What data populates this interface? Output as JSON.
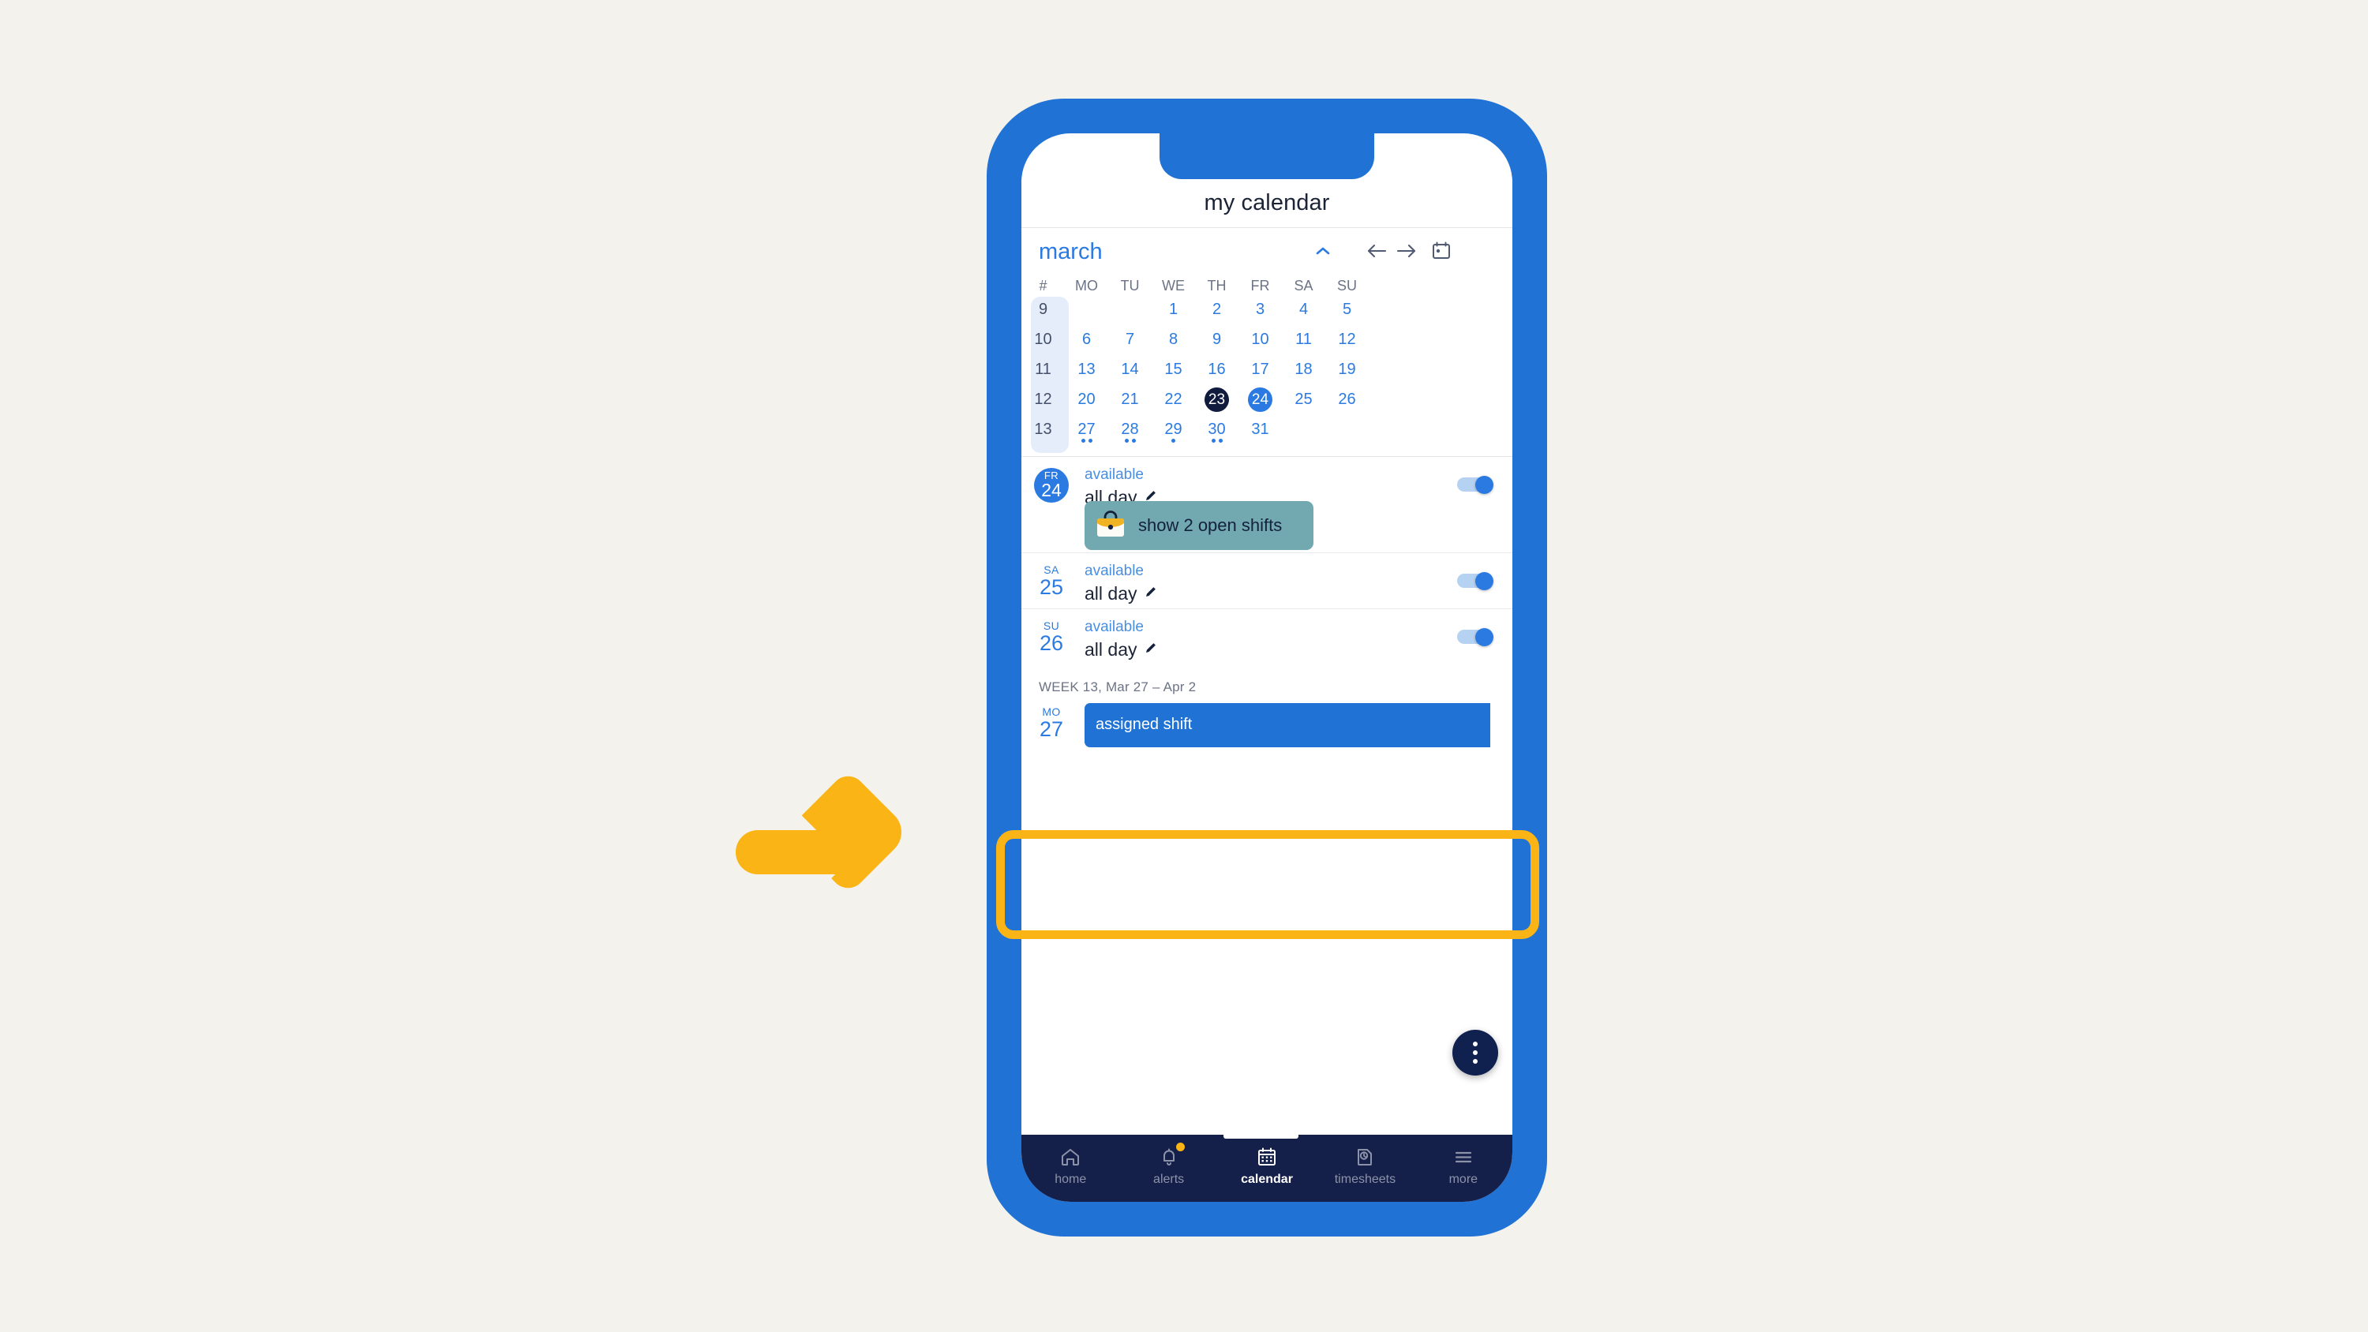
{
  "annotation": {
    "arrow_icon": "arrow-right-icon",
    "arrow_color": "#fbb415",
    "highlight_color": "#fbb415",
    "highlight_target": "saturday-25-availability-row"
  },
  "theme": {
    "background": "#f4f2ed",
    "phone_frame": "#2072d4",
    "accent_blue": "#2a7ae2",
    "dark_navy": "#15204a",
    "today_dark": "#101b3d",
    "teal_button": "#72a8b0",
    "amber": "#fbb415"
  },
  "header": {
    "title": "my calendar"
  },
  "month_bar": {
    "month": "march",
    "collapse_icon": "chevron-up-icon",
    "prev_icon": "arrow-left-icon",
    "next_icon": "arrow-right-icon",
    "today_icon": "calendar-today-icon"
  },
  "calendar": {
    "weeknum_header": "#",
    "day_headers": [
      "MO",
      "TU",
      "WE",
      "TH",
      "FR",
      "SA",
      "SU"
    ],
    "weeks": [
      {
        "num": "9",
        "days": [
          "",
          "",
          "1",
          "2",
          "3",
          "4",
          "5"
        ]
      },
      {
        "num": "10",
        "days": [
          "6",
          "7",
          "8",
          "9",
          "10",
          "11",
          "12"
        ]
      },
      {
        "num": "11",
        "days": [
          "13",
          "14",
          "15",
          "16",
          "17",
          "18",
          "19"
        ]
      },
      {
        "num": "12",
        "days": [
          "20",
          "21",
          "22",
          "23",
          "24",
          "25",
          "26"
        ]
      },
      {
        "num": "13",
        "days": [
          "27",
          "28",
          "29",
          "30",
          "31",
          "",
          ""
        ]
      }
    ],
    "today": "23",
    "selected": "24",
    "event_dots": {
      "27": 2,
      "28": 2,
      "29": 1,
      "30": 2
    }
  },
  "agenda": {
    "rows": [
      {
        "day_of_week": "FR",
        "day_number": "24",
        "status": "available",
        "time": "all day",
        "edit_icon": "pencil-icon",
        "toggle_on": true,
        "open_shifts_label": "show 2 open shifts",
        "open_shifts_icon": "briefcase-icon"
      },
      {
        "day_of_week": "SA",
        "day_number": "25",
        "status": "available",
        "time": "all day",
        "edit_icon": "pencil-icon",
        "toggle_on": true
      },
      {
        "day_of_week": "SU",
        "day_number": "26",
        "status": "available",
        "time": "all day",
        "edit_icon": "pencil-icon",
        "toggle_on": true
      }
    ],
    "week_header": "WEEK 13, Mar 27 – Apr 2",
    "next_week_row": {
      "day_of_week": "MO",
      "day_number": "27",
      "shift_label": "assigned shift"
    },
    "fab_icon": "more-vertical-icon"
  },
  "bottom_nav": {
    "items": [
      {
        "label": "home",
        "icon": "home-icon",
        "active": false,
        "badge": false
      },
      {
        "label": "alerts",
        "icon": "bell-icon",
        "active": false,
        "badge": true
      },
      {
        "label": "calendar",
        "icon": "calendar-icon",
        "active": true,
        "badge": false
      },
      {
        "label": "timesheets",
        "icon": "timesheet-icon",
        "active": false,
        "badge": false
      },
      {
        "label": "more",
        "icon": "hamburger-icon",
        "active": false,
        "badge": false
      }
    ]
  }
}
